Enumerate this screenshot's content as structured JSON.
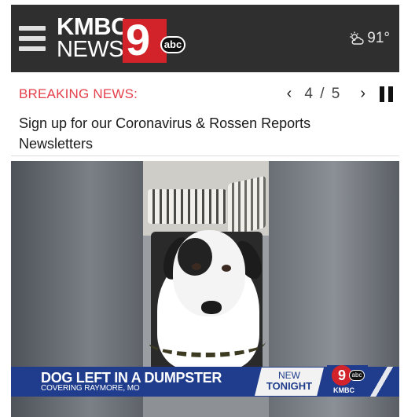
{
  "header": {
    "logo_line1": "KMBC",
    "logo_line2": "NEWS",
    "logo_number": "9",
    "logo_network": "abc",
    "weather_icon": "partly-sunny-icon",
    "temperature": "91°"
  },
  "ticker": {
    "label": "BREAKING NEWS:",
    "prev_icon": "chevron-left-icon",
    "next_icon": "chevron-right-icon",
    "prev_symbol": "‹",
    "next_symbol": "›",
    "position": "4 / 5",
    "pause_icon": "pause-icon",
    "headline": "Sign up for our Coronavirus & Rossen Reports Newsletters"
  },
  "video": {
    "lower_third_title": "DOG LEFT IN A DUMPSTER",
    "lower_third_subtitle": "COVERING RAYMORE, MO",
    "tag_line1": "NEW",
    "tag_line2": "TONIGHT",
    "badge_number": "9",
    "badge_network": "abc",
    "badge_station": "KMBC"
  },
  "colors": {
    "header_bg": "#2f2f2f",
    "breaking_red": "#e4404b",
    "brand_red": "#d2232a",
    "lower_third_blue": "#1f3d8c"
  }
}
